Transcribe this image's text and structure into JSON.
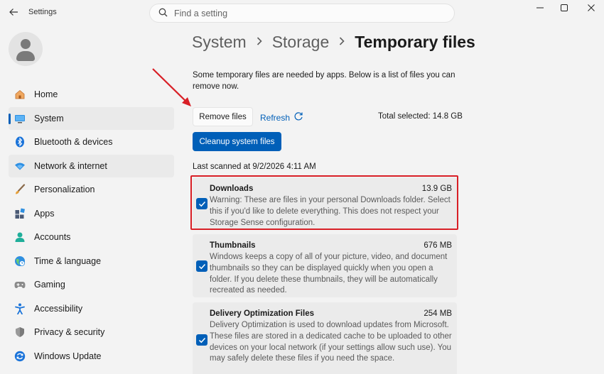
{
  "window": {
    "title": "Settings",
    "minimize": "—",
    "maximize": "☐",
    "close": "✕"
  },
  "search": {
    "placeholder": "Find a setting"
  },
  "sidebar": {
    "items": [
      {
        "label": "Home",
        "icon": "home-icon"
      },
      {
        "label": "System",
        "icon": "system-icon",
        "active": true
      },
      {
        "label": "Bluetooth & devices",
        "icon": "bluetooth-icon"
      },
      {
        "label": "Network & internet",
        "icon": "wifi-icon"
      },
      {
        "label": "Personalization",
        "icon": "brush-icon"
      },
      {
        "label": "Apps",
        "icon": "apps-icon"
      },
      {
        "label": "Accounts",
        "icon": "accounts-icon"
      },
      {
        "label": "Time & language",
        "icon": "globe-icon"
      },
      {
        "label": "Gaming",
        "icon": "gamepad-icon"
      },
      {
        "label": "Accessibility",
        "icon": "accessibility-icon"
      },
      {
        "label": "Privacy & security",
        "icon": "shield-icon"
      },
      {
        "label": "Windows Update",
        "icon": "update-icon"
      }
    ]
  },
  "breadcrumb": {
    "items": [
      "System",
      "Storage",
      "Temporary files"
    ]
  },
  "main": {
    "description": "Some temporary files are needed by apps. Below is a list of files you can remove now.",
    "remove_label": "Remove files",
    "refresh_label": "Refresh",
    "total_selected": "Total selected: 14.8 GB",
    "cleanup_label": "Cleanup system files",
    "last_scanned": "Last scanned at 9/2/2026 4:11 AM",
    "categories": [
      {
        "title": "Downloads",
        "size": "13.9 GB",
        "checked": true,
        "description": "Warning: These are files in your personal Downloads folder. Select this if you'd like to delete everything. This does not respect your Storage Sense configuration."
      },
      {
        "title": "Thumbnails",
        "size": "676 MB",
        "checked": true,
        "description": "Windows keeps a copy of all of your picture, video, and document thumbnails so they can be displayed quickly when you open a folder. If you delete these thumbnails, they will be automatically recreated as needed."
      },
      {
        "title": "Delivery Optimization Files",
        "size": "254 MB",
        "checked": true,
        "description": "Delivery Optimization is used to download updates from Microsoft. These files are stored in a dedicated cache to be uploaded to other devices on your local network (if your settings allow such use). You may safely delete these files if you need the space."
      }
    ]
  },
  "colors": {
    "accent": "#005fb8",
    "highlight": "#d81f26"
  }
}
